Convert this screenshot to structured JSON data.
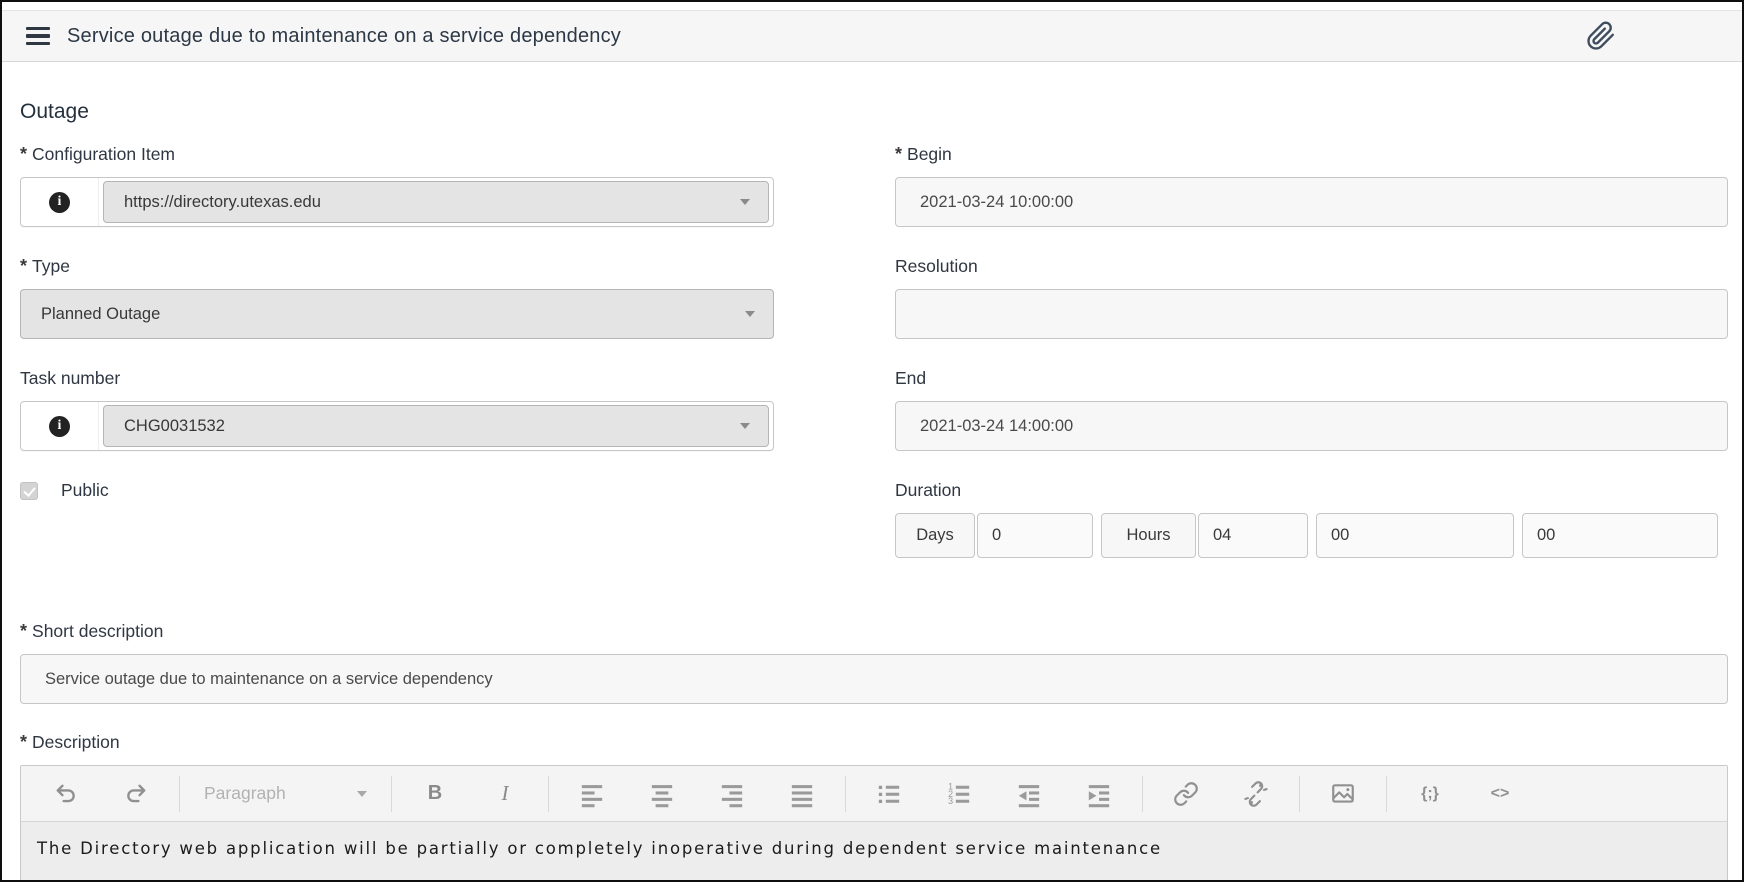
{
  "header": {
    "title": "Service outage due to maintenance on a service dependency"
  },
  "required_marker": "*",
  "section_title": "Outage",
  "fields": {
    "configuration_item": {
      "label": "Configuration Item",
      "required": true,
      "value": "https://directory.utexas.edu"
    },
    "type": {
      "label": "Type",
      "required": true,
      "value": "Planned Outage"
    },
    "task_number": {
      "label": "Task number",
      "required": false,
      "value": "CHG0031532"
    },
    "public": {
      "label": "Public",
      "checked": true
    },
    "begin": {
      "label": "Begin",
      "required": true,
      "value": "2021-03-24 10:00:00"
    },
    "resolution": {
      "label": "Resolution",
      "required": false,
      "value": ""
    },
    "end": {
      "label": "End",
      "required": false,
      "value": "2021-03-24 14:00:00"
    },
    "duration": {
      "label": "Duration",
      "days_label": "Days",
      "days_value": "0",
      "hours_label": "Hours",
      "hours_value": "04",
      "minutes_value": "00",
      "seconds_value": "00"
    },
    "short_description": {
      "label": "Short description",
      "required": true,
      "value": "Service outage due to maintenance on a service dependency"
    },
    "description": {
      "label": "Description",
      "required": true,
      "value": "The Directory web application will be partially or completely inoperative during dependent service maintenance"
    }
  },
  "editor_toolbar": {
    "paragraph_label": "Paragraph",
    "bold_label": "B",
    "italic_label": "I",
    "code_sample_label": "{;}",
    "source_code_label": "<>",
    "icon_names": [
      "undo-icon",
      "redo-icon",
      "caret-down-icon",
      "align-left-icon",
      "align-center-icon",
      "align-right-icon",
      "align-justify-icon",
      "bullet-list-icon",
      "numbered-list-icon",
      "outdent-icon",
      "indent-icon",
      "link-icon",
      "unlink-icon",
      "image-icon"
    ]
  },
  "icons": {
    "menu": "hamburger-icon",
    "attachment": "paperclip-icon",
    "reference_info": "info-icon"
  },
  "colors": {
    "frame_border": "#0f0f0f",
    "header_bg": "#f6f6f6",
    "select_bg": "#e4e4e4",
    "input_bg": "#f7f7f7",
    "label_text": "#2e3742",
    "toolbar_bg": "#f4f4f4",
    "editor_content_bg": "#ededed",
    "icon_gray": "#909090",
    "info_circle": "#222222"
  }
}
